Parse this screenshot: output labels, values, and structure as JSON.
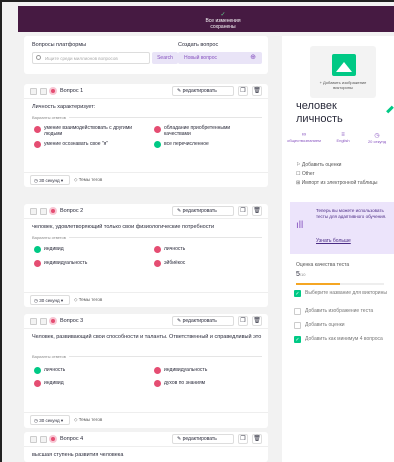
{
  "header": {
    "saved_line1": "Все изменения",
    "saved_line2": "сохранены",
    "bg": "#461a42"
  },
  "search": {
    "label": "Вопросы платформы",
    "placeholder": "Ищите среди миллионов вопросов",
    "button": "Search"
  },
  "create": {
    "label": "Создать вопрос",
    "new": "Новый вопрос"
  },
  "actions": {
    "edit": "редактировать",
    "tags": "Темы тегов",
    "variants": "Варианты ответов"
  },
  "questions": [
    {
      "label": "Вопрос 1",
      "text": "Личность характеризует:",
      "time": "30 секунд",
      "options": [
        {
          "text": "умение взаимодействовать с другими людьми",
          "correct": false
        },
        {
          "text": "обладание приобретенными качествами",
          "correct": false
        },
        {
          "text": "умение осознавать свое \"я\"",
          "correct": false
        },
        {
          "text": "все перечисленное",
          "correct": true
        }
      ]
    },
    {
      "label": "Вопрос 2",
      "text": "человек, удовлетворяющий только свои физиологические потребности",
      "time": "30 секунд",
      "options": [
        {
          "text": "индивид",
          "correct": true
        },
        {
          "text": "личность",
          "correct": false
        },
        {
          "text": "индивидуальность",
          "correct": false
        },
        {
          "text": "эйбиёкос",
          "correct": false
        }
      ]
    },
    {
      "label": "Вопрос 3",
      "text": "Человек, развивающий свои способности и таланты. Ответственный и справедливый это",
      "time": "30 секунд",
      "options": [
        {
          "text": "личность",
          "correct": true
        },
        {
          "text": "индивидуальность",
          "correct": false
        },
        {
          "text": "индивид",
          "correct": false
        },
        {
          "text": "духов по знаниям",
          "correct": false
        }
      ]
    },
    {
      "label": "Вопрос 4",
      "text": "высшая ступень развития человека"
    }
  ],
  "sidebar": {
    "thumb_text": "+ Добавить изображение викторины",
    "title": "человек личность",
    "meta": [
      {
        "icon": "∞",
        "label": "обществознанием"
      },
      {
        "icon": "≡",
        "label": "English"
      },
      {
        "icon": "◷",
        "label": "20 секунд"
      }
    ],
    "links": [
      "Добавить оценки",
      "Other",
      "Импорт из электронной таблицы"
    ],
    "promo_text": "Теперь вы можете использовать тесты для адаптивного обучения.",
    "promo_link": "Узнать больше",
    "quality_label": "Оценка качества теста",
    "quality_value": "5",
    "quality_max": "/10",
    "quality_fraction": 0.5,
    "checklist": [
      {
        "text": "Выберите название для викторины",
        "done": true
      },
      {
        "text": "Добавить изображение теста",
        "done": false
      },
      {
        "text": "Добавить оценки",
        "done": false
      },
      {
        "text": "Добавить как минимум 4 вопроса",
        "done": true
      }
    ]
  }
}
